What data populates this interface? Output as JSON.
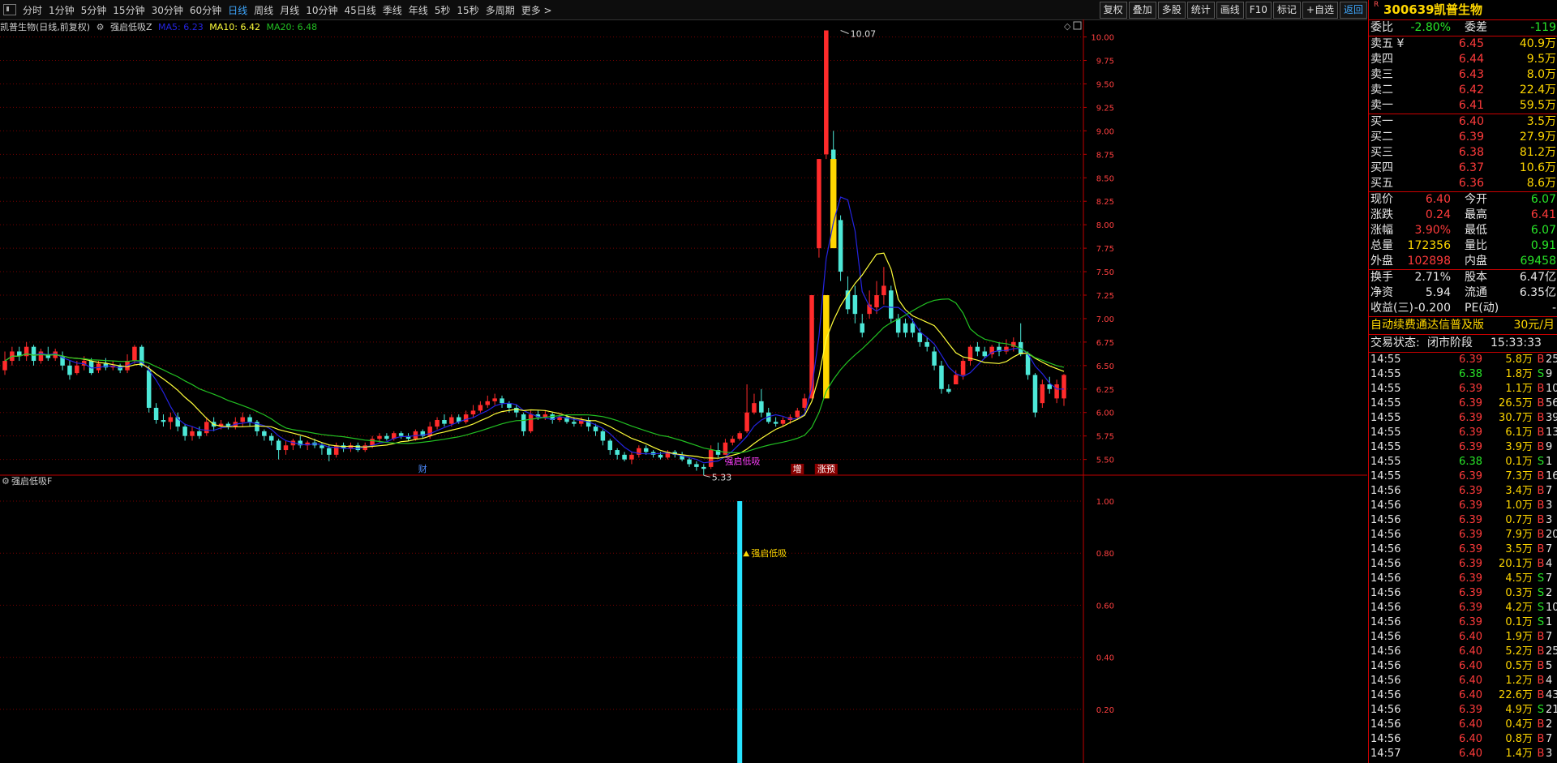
{
  "toolbar": {
    "periods": [
      "分时",
      "1分钟",
      "5分钟",
      "15分钟",
      "30分钟",
      "60分钟",
      "日线",
      "周线",
      "月线",
      "10分钟",
      "45日线",
      "季线",
      "年线",
      "5秒",
      "15秒",
      "多周期",
      "更多 >"
    ],
    "active_period": "日线",
    "buttons": [
      "复权",
      "叠加",
      "多股",
      "统计",
      "画线",
      "F10",
      "标记",
      "+自选",
      "返回"
    ]
  },
  "title": {
    "stock": "凯普生物(日线,前复权)",
    "indicator": "强启低吸Z",
    "ma5": "MA5: 6.23",
    "ma10": "MA10: 6.42",
    "ma20": "MA20: 6.48"
  },
  "colors": {
    "up": "#ff2b2b",
    "down": "#4de8d8",
    "ma5": "#2424e0",
    "ma10": "#ffff3a",
    "ma20": "#22c022",
    "signal": "#ffd700",
    "bg": "#000000",
    "grid": "#7a0000",
    "axis": "#c00000"
  },
  "chart_data": [
    {
      "type": "candlestick",
      "title": "凯普生物(日线,前复权)",
      "y_ticks": [
        "10.00",
        "9.75",
        "9.50",
        "9.25",
        "9.00",
        "8.75",
        "8.50",
        "8.25",
        "8.00",
        "7.75",
        "7.50",
        "7.25",
        "7.00",
        "6.75",
        "6.50",
        "6.25",
        "6.00",
        "5.75",
        "5.50"
      ],
      "ylim": [
        5.35,
        10.1
      ],
      "candles": [
        [
          6.45,
          6.55,
          6.65,
          6.4
        ],
        [
          6.55,
          6.65,
          6.7,
          6.5
        ],
        [
          6.65,
          6.6,
          6.7,
          6.55
        ],
        [
          6.6,
          6.7,
          6.75,
          6.55
        ],
        [
          6.7,
          6.55,
          6.72,
          6.5
        ],
        [
          6.55,
          6.65,
          6.68,
          6.52
        ],
        [
          6.62,
          6.58,
          6.7,
          6.55
        ],
        [
          6.58,
          6.65,
          6.68,
          6.55
        ],
        [
          6.6,
          6.5,
          6.65,
          6.45
        ],
        [
          6.5,
          6.4,
          6.55,
          6.35
        ],
        [
          6.42,
          6.5,
          6.55,
          6.4
        ],
        [
          6.5,
          6.55,
          6.6,
          6.45
        ],
        [
          6.55,
          6.42,
          6.58,
          6.4
        ],
        [
          6.45,
          6.52,
          6.55,
          6.42
        ],
        [
          6.52,
          6.48,
          6.58,
          6.45
        ],
        [
          6.48,
          6.5,
          6.55,
          6.45
        ],
        [
          6.5,
          6.45,
          6.52,
          6.42
        ],
        [
          6.45,
          6.55,
          6.62,
          6.42
        ],
        [
          6.55,
          6.7,
          6.72,
          6.52
        ],
        [
          6.7,
          6.5,
          6.72,
          6.48
        ],
        [
          6.45,
          6.05,
          6.5,
          6.0
        ],
        [
          6.05,
          5.92,
          6.1,
          5.88
        ],
        [
          5.92,
          5.9,
          5.98,
          5.85
        ],
        [
          5.9,
          5.95,
          6.0,
          5.82
        ],
        [
          5.95,
          5.85,
          6.0,
          5.8
        ],
        [
          5.85,
          5.75,
          5.88,
          5.7
        ],
        [
          5.75,
          5.8,
          5.85,
          5.7
        ],
        [
          5.8,
          5.75,
          5.85,
          5.72
        ],
        [
          5.78,
          5.9,
          5.95,
          5.75
        ],
        [
          5.9,
          5.85,
          5.95,
          5.8
        ],
        [
          5.85,
          5.88,
          5.92,
          5.82
        ],
        [
          5.88,
          5.85,
          5.9,
          5.82
        ],
        [
          5.85,
          5.9,
          5.95,
          5.82
        ],
        [
          5.9,
          5.95,
          6.0,
          5.85
        ],
        [
          5.95,
          5.9,
          5.98,
          5.85
        ],
        [
          5.9,
          5.8,
          5.92,
          5.75
        ],
        [
          5.8,
          5.75,
          5.82,
          5.7
        ],
        [
          5.75,
          5.7,
          5.78,
          5.65
        ],
        [
          5.7,
          5.6,
          5.72,
          5.5
        ],
        [
          5.6,
          5.65,
          5.7,
          5.55
        ],
        [
          5.65,
          5.7,
          5.72,
          5.6
        ],
        [
          5.7,
          5.65,
          5.75,
          5.62
        ],
        [
          5.65,
          5.68,
          5.7,
          5.6
        ],
        [
          5.68,
          5.65,
          5.72,
          5.62
        ],
        [
          5.65,
          5.62,
          5.68,
          5.55
        ],
        [
          5.62,
          5.55,
          5.65,
          5.48
        ],
        [
          5.55,
          5.65,
          5.68,
          5.52
        ],
        [
          5.65,
          5.62,
          5.68,
          5.58
        ],
        [
          5.62,
          5.65,
          5.68,
          5.58
        ],
        [
          5.65,
          5.6,
          5.68,
          5.58
        ],
        [
          5.6,
          5.65,
          5.68,
          5.58
        ],
        [
          5.65,
          5.72,
          5.75,
          5.62
        ],
        [
          5.72,
          5.75,
          5.78,
          5.68
        ],
        [
          5.75,
          5.72,
          5.78,
          5.7
        ],
        [
          5.72,
          5.78,
          5.8,
          5.7
        ],
        [
          5.78,
          5.75,
          5.8,
          5.72
        ],
        [
          5.75,
          5.72,
          5.78,
          5.7
        ],
        [
          5.72,
          5.8,
          5.82,
          5.7
        ],
        [
          5.8,
          5.75,
          5.82,
          5.72
        ],
        [
          5.75,
          5.85,
          5.9,
          5.72
        ],
        [
          5.85,
          5.92,
          5.95,
          5.82
        ],
        [
          5.92,
          5.88,
          5.98,
          5.85
        ],
        [
          5.88,
          5.95,
          5.98,
          5.85
        ],
        [
          5.95,
          5.9,
          5.98,
          5.88
        ],
        [
          5.9,
          5.98,
          6.02,
          5.88
        ],
        [
          5.98,
          6.02,
          6.08,
          5.95
        ],
        [
          6.02,
          6.08,
          6.12,
          6.0
        ],
        [
          6.08,
          6.12,
          6.18,
          6.05
        ],
        [
          6.12,
          6.15,
          6.2,
          6.08
        ],
        [
          6.15,
          6.1,
          6.18,
          6.05
        ],
        [
          6.1,
          6.05,
          6.12,
          6.0
        ],
        [
          6.05,
          6.0,
          6.08,
          5.95
        ],
        [
          5.98,
          5.8,
          6.0,
          5.75
        ],
        [
          5.8,
          5.98,
          6.02,
          5.78
        ],
        [
          5.98,
          5.95,
          6.02,
          5.92
        ],
        [
          5.95,
          5.98,
          6.02,
          5.92
        ],
        [
          5.98,
          5.92,
          6.0,
          5.88
        ],
        [
          5.92,
          5.95,
          5.98,
          5.9
        ],
        [
          5.95,
          5.9,
          5.98,
          5.88
        ],
        [
          5.9,
          5.88,
          5.95,
          5.85
        ],
        [
          5.88,
          5.92,
          5.95,
          5.85
        ],
        [
          5.92,
          5.85,
          5.95,
          5.8
        ],
        [
          5.85,
          5.8,
          5.88,
          5.75
        ],
        [
          5.8,
          5.7,
          5.82,
          5.65
        ],
        [
          5.7,
          5.6,
          5.72,
          5.55
        ],
        [
          5.6,
          5.55,
          5.62,
          5.5
        ],
        [
          5.55,
          5.5,
          5.58,
          5.48
        ],
        [
          5.5,
          5.55,
          5.58,
          5.45
        ],
        [
          5.55,
          5.62,
          5.65,
          5.52
        ],
        [
          5.62,
          5.58,
          5.65,
          5.55
        ],
        [
          5.58,
          5.55,
          5.6,
          5.52
        ],
        [
          5.55,
          5.52,
          5.58,
          5.5
        ],
        [
          5.52,
          5.58,
          5.6,
          5.5
        ],
        [
          5.58,
          5.55,
          5.6,
          5.52
        ],
        [
          5.55,
          5.5,
          5.58,
          5.48
        ],
        [
          5.5,
          5.45,
          5.52,
          5.42
        ],
        [
          5.45,
          5.42,
          5.48,
          5.38
        ],
        [
          5.42,
          5.4,
          5.45,
          5.33
        ],
        [
          5.42,
          5.6,
          5.65,
          5.4
        ],
        [
          5.6,
          5.55,
          5.68,
          5.52
        ],
        [
          5.55,
          5.68,
          5.72,
          5.55
        ],
        [
          5.68,
          5.72,
          5.75,
          5.65
        ],
        [
          5.72,
          5.78,
          5.8,
          5.7
        ],
        [
          5.8,
          6.0,
          6.3,
          5.78
        ],
        [
          6.0,
          6.1,
          6.2,
          5.98
        ],
        [
          6.12,
          6.0,
          6.25,
          5.95
        ],
        [
          6.0,
          5.9,
          6.05,
          5.88
        ],
        [
          5.9,
          5.88,
          5.95,
          5.85
        ],
        [
          5.88,
          5.92,
          5.95,
          5.85
        ],
        [
          5.92,
          5.95,
          5.98,
          5.88
        ],
        [
          5.95,
          6.02,
          6.05,
          5.92
        ],
        [
          6.05,
          6.15,
          6.2,
          6.02
        ],
        [
          6.15,
          7.25,
          7.25,
          6.15
        ],
        [
          7.75,
          8.7,
          8.7,
          7.65
        ],
        [
          8.75,
          10.07,
          10.07,
          8.7
        ],
        [
          8.8,
          7.95,
          9.0,
          7.9
        ],
        [
          8.05,
          7.5,
          8.1,
          7.4
        ],
        [
          7.3,
          7.1,
          7.45,
          7.05
        ],
        [
          7.25,
          7.05,
          7.35,
          6.95
        ],
        [
          6.95,
          6.85,
          7.05,
          6.8
        ],
        [
          7.05,
          7.15,
          7.3,
          7.0
        ],
        [
          7.12,
          7.25,
          7.4,
          7.05
        ],
        [
          7.25,
          7.35,
          7.55,
          7.15
        ],
        [
          7.3,
          7.0,
          7.35,
          6.95
        ],
        [
          7.0,
          6.85,
          7.05,
          6.8
        ],
        [
          6.95,
          6.85,
          7.0,
          6.8
        ],
        [
          6.95,
          6.85,
          7.0,
          6.8
        ],
        [
          6.85,
          6.75,
          6.9,
          6.7
        ],
        [
          6.75,
          6.7,
          6.8,
          6.65
        ],
        [
          6.65,
          6.5,
          6.7,
          6.45
        ],
        [
          6.5,
          6.25,
          6.55,
          6.2
        ],
        [
          6.25,
          6.22,
          6.3,
          6.2
        ],
        [
          6.3,
          6.4,
          6.45,
          6.3
        ],
        [
          6.4,
          6.55,
          6.58,
          6.35
        ],
        [
          6.55,
          6.7,
          6.72,
          6.5
        ],
        [
          6.7,
          6.65,
          6.75,
          6.6
        ],
        [
          6.65,
          6.6,
          6.7,
          6.58
        ],
        [
          6.62,
          6.7,
          6.72,
          6.58
        ],
        [
          6.7,
          6.65,
          6.75,
          6.6
        ],
        [
          6.65,
          6.7,
          6.78,
          6.62
        ],
        [
          6.7,
          6.75,
          6.8,
          6.65
        ],
        [
          6.75,
          6.62,
          6.95,
          6.6
        ],
        [
          6.62,
          6.4,
          6.65,
          6.35
        ],
        [
          6.4,
          6.0,
          6.42,
          5.95
        ],
        [
          6.1,
          6.3,
          6.35,
          6.05
        ],
        [
          6.3,
          6.25,
          6.38,
          6.2
        ],
        [
          6.15,
          6.3,
          6.35,
          6.1
        ],
        [
          6.15,
          6.4,
          6.41,
          6.07
        ]
      ],
      "ma5_legend": "MA5: 6.23",
      "ma10_legend": "MA10: 6.42",
      "ma20_legend": "MA20: 6.48",
      "annotations": {
        "high": "10.07",
        "low": "5.33",
        "signal_label": "强启低吸",
        "markers": [
          "财",
          "增",
          "涨预"
        ]
      }
    },
    {
      "type": "bar",
      "title": "强启低吸F",
      "y_ticks": [
        "1.00",
        "0.80",
        "0.60",
        "0.40",
        "0.20"
      ],
      "ylim": [
        0,
        1.05
      ],
      "bars": [
        {
          "index": 102,
          "value": 1.0
        }
      ],
      "annotation": "强启低吸"
    }
  ],
  "panel": {
    "code": "300639",
    "name": "凯普生物",
    "badge": "R",
    "webi_label": "委比",
    "webi_value": "-2.80%",
    "weicha_label": "委差",
    "weicha_value": "-119",
    "sells": [
      {
        "label": "卖五 ¥",
        "price": "6.45",
        "vol": "40.9万"
      },
      {
        "label": "卖四",
        "price": "6.44",
        "vol": "9.5万"
      },
      {
        "label": "卖三",
        "price": "6.43",
        "vol": "8.0万"
      },
      {
        "label": "卖二",
        "price": "6.42",
        "vol": "22.4万"
      },
      {
        "label": "卖一",
        "price": "6.41",
        "vol": "59.5万"
      }
    ],
    "buys": [
      {
        "label": "买一",
        "price": "6.40",
        "vol": "3.5万"
      },
      {
        "label": "买二",
        "price": "6.39",
        "vol": "27.9万"
      },
      {
        "label": "买三",
        "price": "6.38",
        "vol": "81.2万"
      },
      {
        "label": "买四",
        "price": "6.37",
        "vol": "10.6万"
      },
      {
        "label": "买五",
        "price": "6.36",
        "vol": "8.6万"
      }
    ],
    "stats": [
      {
        "l1": "现价",
        "v1": "6.40",
        "c1": "red",
        "l2": "今开",
        "v2": "6.07",
        "c2": "green"
      },
      {
        "l1": "涨跌",
        "v1": "0.24",
        "c1": "red",
        "l2": "最高",
        "v2": "6.41",
        "c2": "red"
      },
      {
        "l1": "涨幅",
        "v1": "3.90%",
        "c1": "red",
        "l2": "最低",
        "v2": "6.07",
        "c2": "green"
      },
      {
        "l1": "总量",
        "v1": "172356",
        "c1": "yellow",
        "l2": "量比",
        "v2": "0.91",
        "c2": "green"
      },
      {
        "l1": "外盘",
        "v1": "102898",
        "c1": "red",
        "l2": "内盘",
        "v2": "69458",
        "c2": "green"
      }
    ],
    "stats2": [
      {
        "l1": "换手",
        "v1": "2.71%",
        "l2": "股本",
        "v2": "6.47亿"
      },
      {
        "l1": "净资",
        "v1": "5.94",
        "l2": "流通",
        "v2": "6.35亿"
      },
      {
        "l1": "收益(三)",
        "v1": "-0.200",
        "l2": "PE(动)",
        "v2": "-"
      }
    ],
    "promo": "自动续费通达信普及版",
    "promo_price": "30元/月",
    "trade_status_label": "交易状态:",
    "trade_status": "闭市阶段",
    "trade_time": "15:33:33",
    "ticks": [
      {
        "t": "14:55",
        "p": "6.39",
        "v": "5.8万",
        "d": "B",
        "n": "25"
      },
      {
        "t": "14:55",
        "p": "6.38",
        "v": "1.8万",
        "d": "S",
        "n": "9"
      },
      {
        "t": "14:55",
        "p": "6.39",
        "v": "1.1万",
        "d": "B",
        "n": "10"
      },
      {
        "t": "14:55",
        "p": "6.39",
        "v": "26.5万",
        "d": "B",
        "n": "56"
      },
      {
        "t": "14:55",
        "p": "6.39",
        "v": "30.7万",
        "d": "B",
        "n": "39"
      },
      {
        "t": "14:55",
        "p": "6.39",
        "v": "6.1万",
        "d": "B",
        "n": "13"
      },
      {
        "t": "14:55",
        "p": "6.39",
        "v": "3.9万",
        "d": "B",
        "n": "9"
      },
      {
        "t": "14:55",
        "p": "6.38",
        "v": "0.1万",
        "d": "S",
        "n": "1"
      },
      {
        "t": "14:55",
        "p": "6.39",
        "v": "7.3万",
        "d": "B",
        "n": "16"
      },
      {
        "t": "14:56",
        "p": "6.39",
        "v": "3.4万",
        "d": "B",
        "n": "7"
      },
      {
        "t": "14:56",
        "p": "6.39",
        "v": "1.0万",
        "d": "B",
        "n": "3"
      },
      {
        "t": "14:56",
        "p": "6.39",
        "v": "0.7万",
        "d": "B",
        "n": "3"
      },
      {
        "t": "14:56",
        "p": "6.39",
        "v": "7.9万",
        "d": "B",
        "n": "20"
      },
      {
        "t": "14:56",
        "p": "6.39",
        "v": "3.5万",
        "d": "B",
        "n": "7"
      },
      {
        "t": "14:56",
        "p": "6.39",
        "v": "20.1万",
        "d": "B",
        "n": "4"
      },
      {
        "t": "14:56",
        "p": "6.39",
        "v": "4.5万",
        "d": "S",
        "n": "7"
      },
      {
        "t": "14:56",
        "p": "6.39",
        "v": "0.3万",
        "d": "S",
        "n": "2"
      },
      {
        "t": "14:56",
        "p": "6.39",
        "v": "4.2万",
        "d": "S",
        "n": "10"
      },
      {
        "t": "14:56",
        "p": "6.39",
        "v": "0.1万",
        "d": "S",
        "n": "1"
      },
      {
        "t": "14:56",
        "p": "6.40",
        "v": "1.9万",
        "d": "B",
        "n": "7"
      },
      {
        "t": "14:56",
        "p": "6.40",
        "v": "5.2万",
        "d": "B",
        "n": "25"
      },
      {
        "t": "14:56",
        "p": "6.40",
        "v": "0.5万",
        "d": "B",
        "n": "5"
      },
      {
        "t": "14:56",
        "p": "6.40",
        "v": "1.2万",
        "d": "B",
        "n": "4"
      },
      {
        "t": "14:56",
        "p": "6.40",
        "v": "22.6万",
        "d": "B",
        "n": "43"
      },
      {
        "t": "14:56",
        "p": "6.39",
        "v": "4.9万",
        "d": "S",
        "n": "21"
      },
      {
        "t": "14:56",
        "p": "6.40",
        "v": "0.4万",
        "d": "B",
        "n": "2"
      },
      {
        "t": "14:56",
        "p": "6.40",
        "v": "0.8万",
        "d": "B",
        "n": "7"
      },
      {
        "t": "14:57",
        "p": "6.40",
        "v": "1.4万",
        "d": "B",
        "n": "3"
      }
    ]
  }
}
